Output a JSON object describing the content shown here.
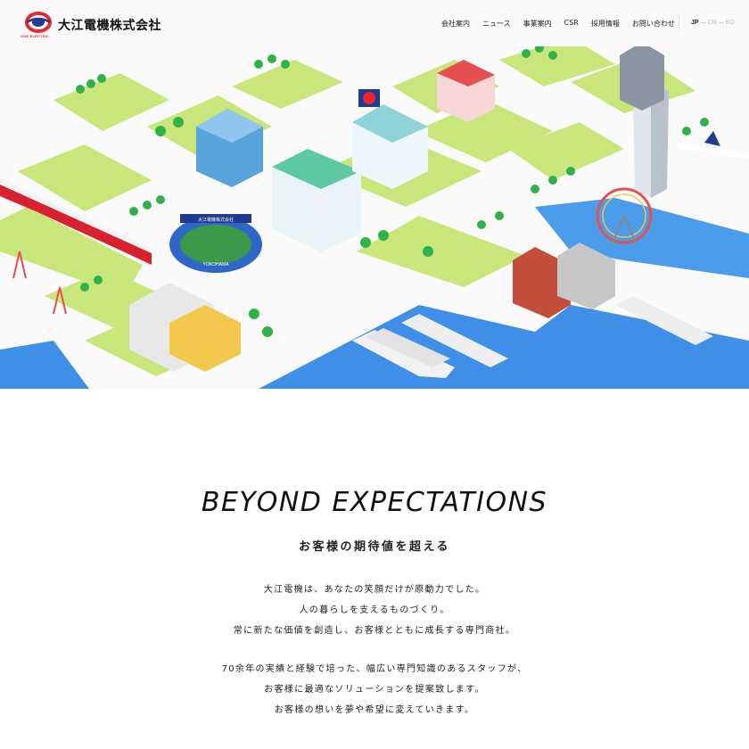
{
  "header": {
    "company_name": "大江電機株式会社",
    "logo_caption": "OHE ELECTRIC",
    "nav": [
      {
        "label": "会社案内"
      },
      {
        "label": "ニュース"
      },
      {
        "label": "事業案内"
      },
      {
        "label": "CSR"
      },
      {
        "label": "採用情報"
      },
      {
        "label": "お問い合わせ"
      }
    ],
    "languages": [
      {
        "label": "JP",
        "active": true
      },
      {
        "label": "CN",
        "active": false
      },
      {
        "label": "KO",
        "active": false
      }
    ]
  },
  "hero": {
    "stadium_banner": "大江電機株式会社",
    "stadium_name": "YOKOHAMA"
  },
  "intro": {
    "headline": "BEYOND EXPECTATIONS",
    "subheadline": "お客様の期待値を超える",
    "paragraph1": [
      "大江電機は、あなたの笑顔だけが原動力でした。",
      "人の暮らしを支えるものづくり。",
      "常に新たな価値を創造し、お客様とともに成長する専門商社。"
    ],
    "paragraph2": [
      "70余年の実績と経験で培った、幅広い専門知識のあるスタッフが、",
      "お客様に最適なソリューションを提案致します。",
      "お客様の想いを夢や希望に変えていきます。"
    ]
  },
  "colors": {
    "brand_red": "#e6282e",
    "brand_blue": "#1f3c8f",
    "grass": "#c9e67a",
    "water": "#3f8fe8",
    "road": "#ffffff",
    "tree": "#2fb24a"
  }
}
